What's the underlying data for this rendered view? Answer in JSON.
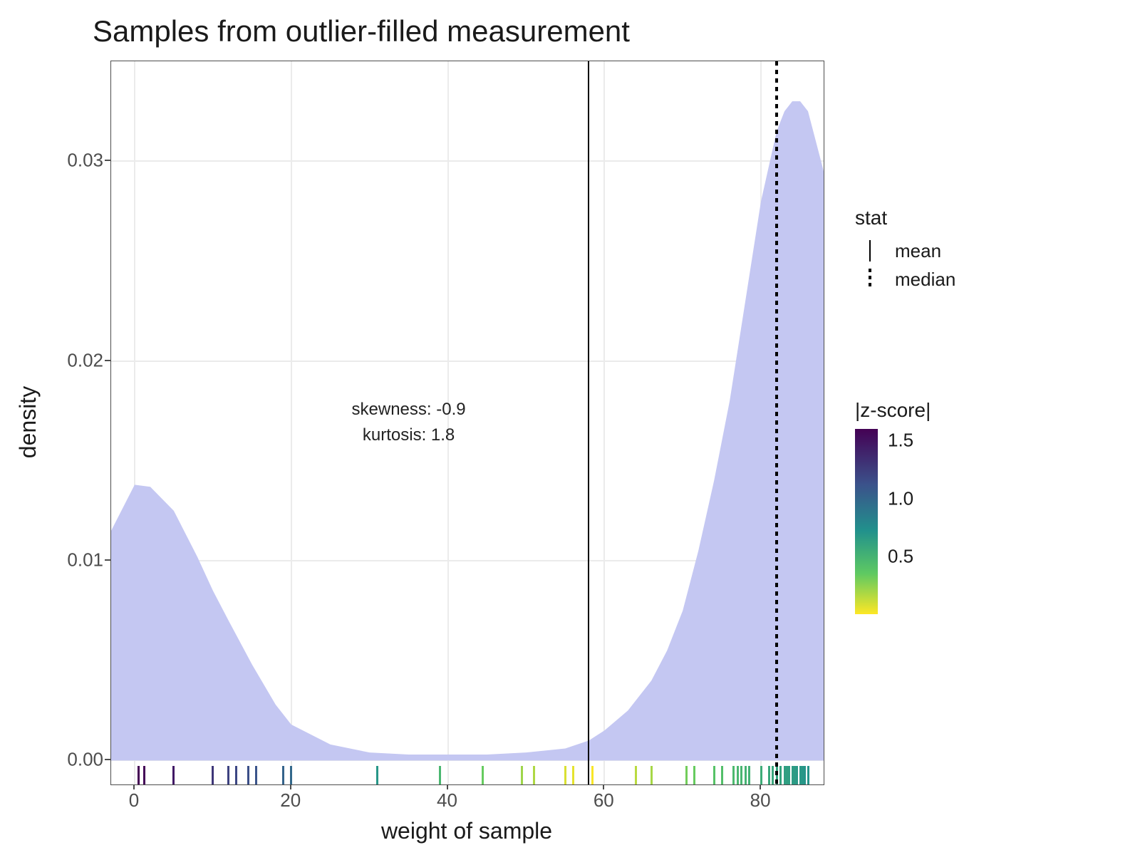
{
  "chart_data": {
    "type": "density_with_rug",
    "title": "Samples from outlier-filled measurement",
    "xlabel": "weight of sample",
    "ylabel": "density",
    "xlim": [
      -3,
      88
    ],
    "ylim": [
      -0.0012,
      0.035
    ],
    "x_ticks": [
      0,
      20,
      40,
      60,
      80
    ],
    "y_ticks": [
      0.0,
      0.01,
      0.02,
      0.03
    ],
    "grid": true,
    "density": {
      "fill": "#c4c7f2",
      "x": [
        -3,
        0,
        2,
        5,
        8,
        10,
        12,
        15,
        18,
        20,
        25,
        30,
        35,
        40,
        45,
        50,
        55,
        58,
        60,
        63,
        66,
        68,
        70,
        72,
        74,
        76,
        78,
        80,
        82,
        83,
        84,
        85,
        86,
        87,
        88
      ],
      "y": [
        0.0115,
        0.0138,
        0.0137,
        0.0125,
        0.0102,
        0.0085,
        0.007,
        0.0048,
        0.0028,
        0.0018,
        0.0008,
        0.0004,
        0.0003,
        0.0003,
        0.0003,
        0.0004,
        0.0006,
        0.001,
        0.0015,
        0.0025,
        0.004,
        0.0055,
        0.0075,
        0.0105,
        0.014,
        0.018,
        0.023,
        0.028,
        0.0315,
        0.0325,
        0.033,
        0.033,
        0.0325,
        0.031,
        0.0295
      ]
    },
    "vlines": [
      {
        "stat": "mean",
        "x": 58,
        "linetype": "solid"
      },
      {
        "stat": "median",
        "x": 82,
        "linetype": "dashed"
      }
    ],
    "annotations": [
      {
        "x": 35,
        "y": 0.0175,
        "text_lines": [
          "skewness: -0.9",
          "kurtosis: 1.8"
        ]
      }
    ],
    "rug": {
      "colorscale": "viridis",
      "color_var": "|z-score|",
      "points": [
        {
          "x": 0.5,
          "z": 1.6
        },
        {
          "x": 1.2,
          "z": 1.58
        },
        {
          "x": 5.0,
          "z": 1.48
        },
        {
          "x": 10.0,
          "z": 1.34
        },
        {
          "x": 12.0,
          "z": 1.28
        },
        {
          "x": 13.0,
          "z": 1.26
        },
        {
          "x": 14.5,
          "z": 1.22
        },
        {
          "x": 15.5,
          "z": 1.19
        },
        {
          "x": 19.0,
          "z": 1.09
        },
        {
          "x": 20.0,
          "z": 1.06
        },
        {
          "x": 31.0,
          "z": 0.76
        },
        {
          "x": 39.0,
          "z": 0.53
        },
        {
          "x": 44.5,
          "z": 0.38
        },
        {
          "x": 49.5,
          "z": 0.24
        },
        {
          "x": 51.0,
          "z": 0.2
        },
        {
          "x": 55.0,
          "z": 0.09
        },
        {
          "x": 56.0,
          "z": 0.06
        },
        {
          "x": 58.5,
          "z": 0.01
        },
        {
          "x": 64.0,
          "z": 0.17
        },
        {
          "x": 66.0,
          "z": 0.22
        },
        {
          "x": 70.5,
          "z": 0.35
        },
        {
          "x": 71.5,
          "z": 0.38
        },
        {
          "x": 74.0,
          "z": 0.45
        },
        {
          "x": 75.0,
          "z": 0.47
        },
        {
          "x": 76.5,
          "z": 0.51
        },
        {
          "x": 77.0,
          "z": 0.53
        },
        {
          "x": 77.5,
          "z": 0.54
        },
        {
          "x": 78.0,
          "z": 0.56
        },
        {
          "x": 78.5,
          "z": 0.57
        },
        {
          "x": 80.0,
          "z": 0.61
        },
        {
          "x": 81.0,
          "z": 0.64
        },
        {
          "x": 81.5,
          "z": 0.65
        },
        {
          "x": 82.0,
          "z": 0.67
        },
        {
          "x": 82.5,
          "z": 0.68
        },
        {
          "x": 83.0,
          "z": 0.7
        },
        {
          "x": 83.3,
          "z": 0.7
        },
        {
          "x": 83.6,
          "z": 0.71
        },
        {
          "x": 84.0,
          "z": 0.72
        },
        {
          "x": 84.3,
          "z": 0.73
        },
        {
          "x": 84.6,
          "z": 0.74
        },
        {
          "x": 85.0,
          "z": 0.75
        },
        {
          "x": 85.3,
          "z": 0.76
        },
        {
          "x": 85.6,
          "z": 0.77
        },
        {
          "x": 86.0,
          "z": 0.78
        }
      ]
    },
    "legend_stat": {
      "title": "stat",
      "entries": [
        {
          "label": "mean",
          "linetype": "solid"
        },
        {
          "label": "median",
          "linetype": "dashed"
        }
      ]
    },
    "legend_color": {
      "title": "|z-score|",
      "ticks": [
        1.5,
        1.0,
        0.5
      ],
      "range": [
        0.0,
        1.6
      ]
    }
  }
}
